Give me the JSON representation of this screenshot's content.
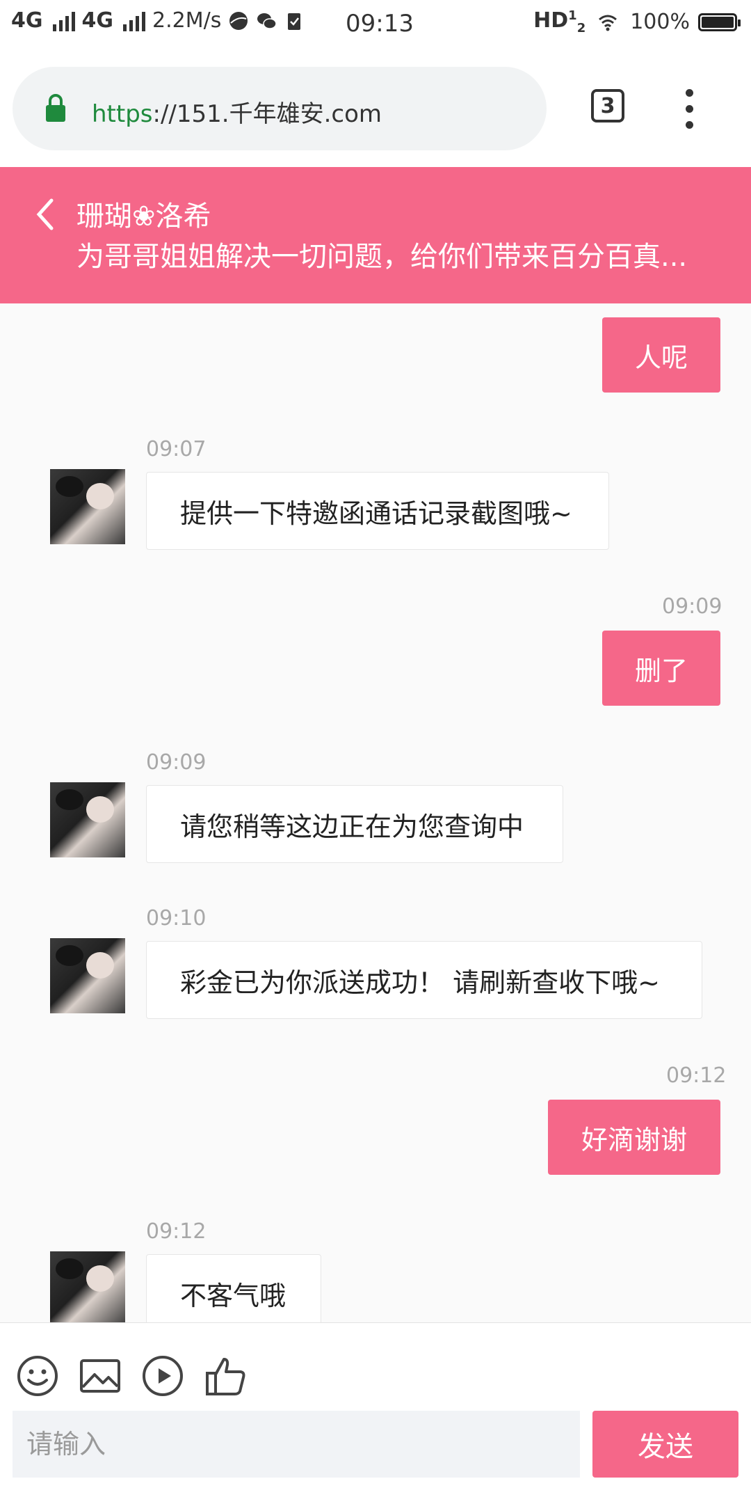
{
  "status_bar": {
    "network1": "4G",
    "network2": "4G",
    "speed": "2.2M/s",
    "time": "09:13",
    "hd": "HD",
    "battery": "100%",
    "battery_level": 1.0
  },
  "browser": {
    "url_scheme": "https",
    "url_rest": "://151.千年雄安.com",
    "tab_count": "3"
  },
  "header": {
    "title": "珊瑚❀洛希",
    "subtitle": "为哥哥姐姐解决一切问题，给你们带来百分百真..."
  },
  "messages": {
    "m1": {
      "text": "人呢"
    },
    "m2": {
      "time": "09:07",
      "text": "提供一下特邀函通话记录截图哦~"
    },
    "m3": {
      "time": "09:09",
      "text": "删了"
    },
    "m4": {
      "time": "09:09",
      "text": "请您稍等这边正在为您查询中"
    },
    "m5": {
      "time": "09:10",
      "text": "彩金已为你派送成功！ 请刷新查收下哦~"
    },
    "m6": {
      "time": "09:12",
      "text": "好滴谢谢"
    },
    "m7": {
      "time": "09:12",
      "text": "不客气哦"
    }
  },
  "input": {
    "placeholder": "请输入",
    "send_label": "发送"
  },
  "colors": {
    "accent": "#f56789",
    "url_green": "#1f8a3d"
  },
  "icons": [
    "lock-icon",
    "back-icon",
    "emoji-icon",
    "image-icon",
    "video-icon",
    "thumbs-up-icon",
    "more-menu-icon"
  ]
}
